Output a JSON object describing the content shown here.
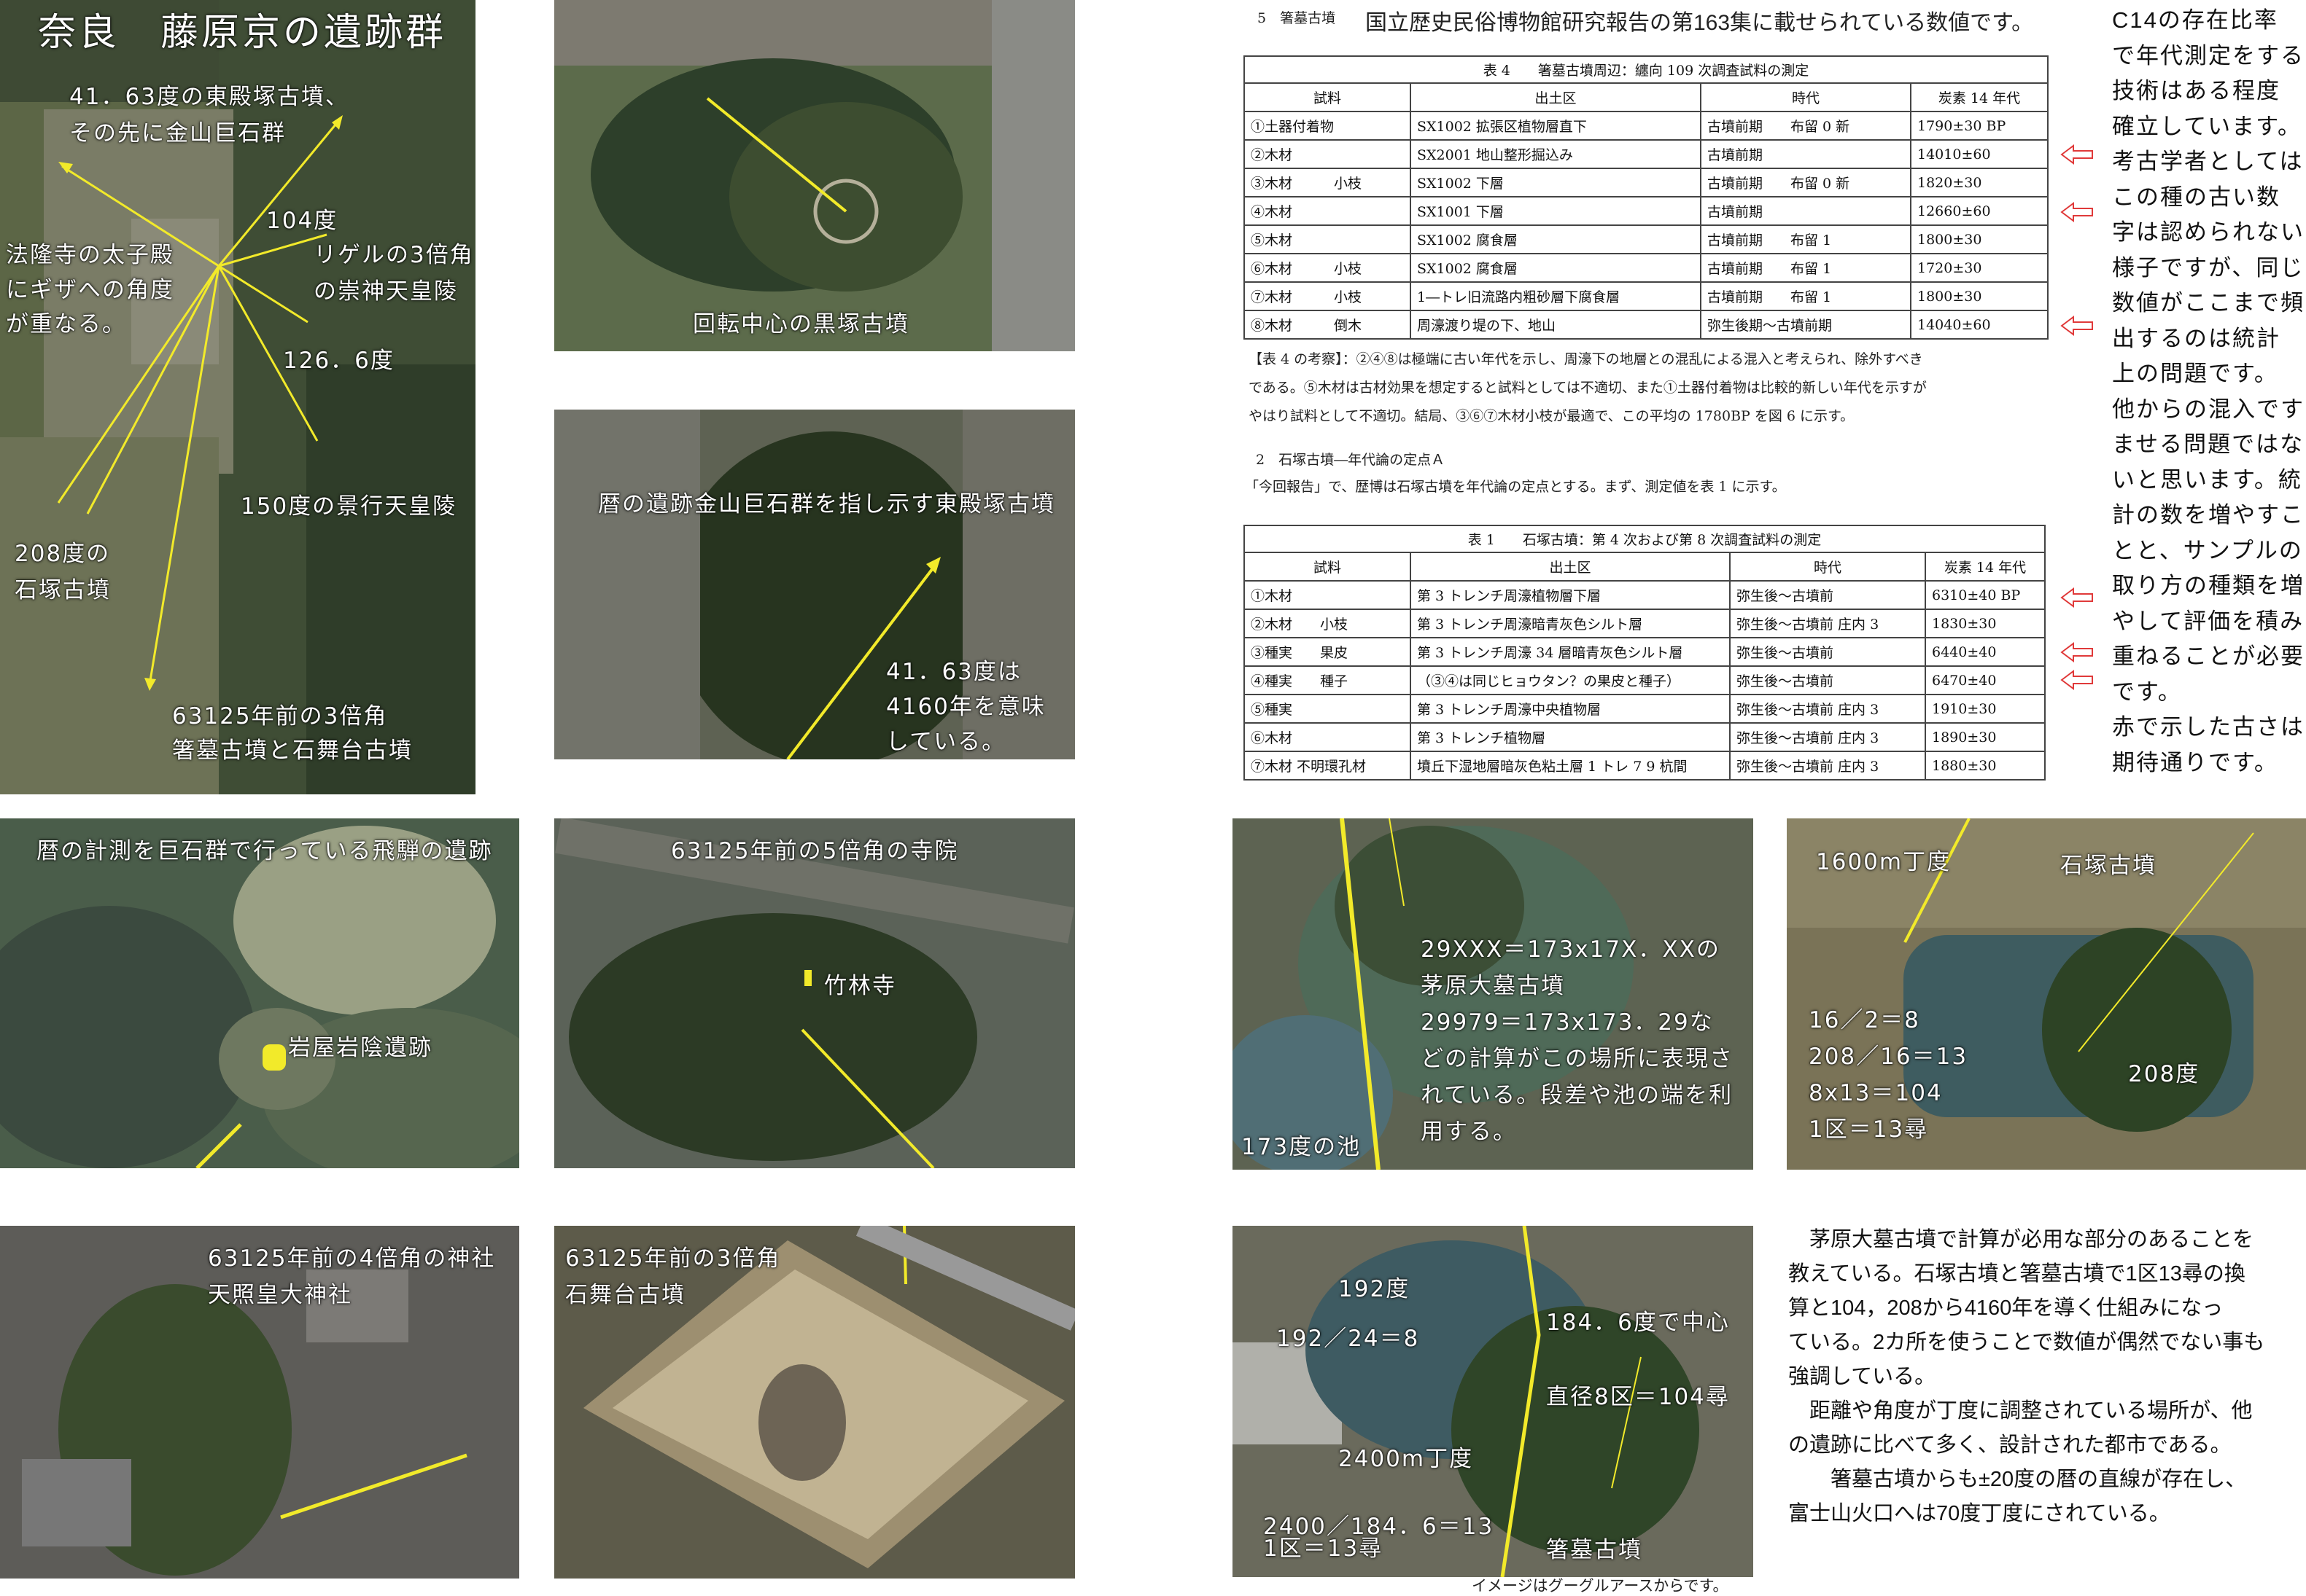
{
  "panels": {
    "main": {
      "title": "奈良　藤原京の遺跡群",
      "l1": "41．63度の東殿塚古墳、",
      "l2": "その先に金山巨石群",
      "l3": "104度",
      "l4": "リゲルの3倍角",
      "l5": "の崇神天皇陵",
      "l6": "法隆寺の太子殿",
      "l7": "にギザへの角度",
      "l8": "が重なる。",
      "l9": "126．6度",
      "l10": "150度の景行天皇陵",
      "l11": "208度の",
      "l12": "石塚古墳",
      "l13": "63125年前の3倍角",
      "l14": "箸墓古墳と石舞台古墳"
    },
    "kurozuka": {
      "label": "回転中心の黒塚古墳"
    },
    "higashitono": {
      "label": "暦の遺跡金山巨石群を指し示す東殿塚古墳",
      "n1": "41．63度は",
      "n2": "4160年を意味",
      "n3": "している。"
    },
    "iwaya": {
      "title": "暦の計測を巨石群で行っている飛騨の遺跡",
      "label": "岩屋岩陰遺跡"
    },
    "chikurin": {
      "title": "63125年前の5倍角の寺院",
      "label": "竹林寺"
    },
    "jinja": {
      "l1": "63125年前の4倍角の神社",
      "l2": "天照皇大神社"
    },
    "ishibutai": {
      "l1": "63125年前の3倍角",
      "l2": "石舞台古墳"
    },
    "chihara": {
      "t1": "29XXX＝173x17X．XXの",
      "t2": "茅原大墓古墳",
      "t3": "29979＝173x173．29な",
      "t4": "どの計算がこの場所に表現さ",
      "t5": "れている。段差や池の端を利",
      "t6": "用する。",
      "pond": "173度の池"
    },
    "ishizuka": {
      "l1": "1600m丁度",
      "l2": "石塚古墳",
      "l3": "16／2＝8",
      "l4": "208／16＝13",
      "l5": "8x13＝104",
      "l6": "1区＝13尋",
      "l7": "208度"
    },
    "hashihaka": {
      "l1": "192度",
      "l2": "192／24＝8",
      "l3": "184．6度で中心",
      "l4": "直径8区＝104尋",
      "l5": "2400m丁度",
      "l6": "2400／184．6＝13",
      "l7": "1区＝13尋",
      "l8": "箸墓古墳"
    }
  },
  "header_note": {
    "num": "5　箸墓古墳",
    "text": "国立歴史民俗博物館研究報告の第163集に載せられている数値です。"
  },
  "table4": {
    "caption": "表 4　　箸墓古墳周辺：纏向 109 次調査試料の測定",
    "headers": [
      "試料",
      "出土区",
      "時代",
      "炭素 14 年代"
    ],
    "rows": [
      [
        "①土器付着物",
        "SX1002 拡張区植物層直下",
        "古墳前期　　布留 0 新",
        "1790±30 BP"
      ],
      [
        "②木材",
        "SX2001 地山整形掘込み",
        "古墳前期",
        "14010±60"
      ],
      [
        "③木材　　　小枝",
        "SX1002 下層",
        "古墳前期　　布留 0 新",
        "1820±30"
      ],
      [
        "④木材",
        "SX1001 下層",
        "古墳前期",
        "12660±60"
      ],
      [
        "⑤木材",
        "SX1002 腐食層",
        "古墳前期　　布留 1",
        "1800±30"
      ],
      [
        "⑥木材　　　小枝",
        "SX1002 腐食層",
        "古墳前期　　布留 1",
        "1720±30"
      ],
      [
        "⑦木材　　　小枝",
        "1―トレ旧流路内粗砂層下腐食層",
        "古墳前期　　布留 1",
        "1800±30"
      ],
      [
        "⑧木材　　　倒木",
        "周濠渡り堤の下、地山",
        "弥生後期～古墳前期",
        "14040±60"
      ]
    ],
    "note1": "【表 4 の考察】：②④⑧は極端に古い年代を示し、周濠下の地層との混乱による混入と考えられ、除外すべき",
    "note2": "である。⑤木材は古材効果を想定すると試料としては不適切、また①土器付着物は比較的新しい年代を示すが",
    "note3": "やはり試料として不適切。結局、③⑥⑦木材小枝が最適で、この平均の 1780BP を図 6 に示す。"
  },
  "section2": {
    "title": "2　石塚古墳―年代論の定点Ａ",
    "text": "「今回報告」で、歴博は石塚古墳を年代論の定点とする。まず、測定値を表 1 に示す。"
  },
  "table1": {
    "caption": "表 1　　石塚古墳：第 4 次および第 8 次調査試料の測定",
    "headers": [
      "試料",
      "出土区",
      "時代",
      "炭素 14 年代"
    ],
    "rows": [
      [
        "①木材",
        "第 3 トレンチ周濠植物層下層",
        "弥生後～古墳前",
        "6310±40 BP"
      ],
      [
        "②木材　　小枝",
        "第 3 トレンチ周濠暗青灰色シルト層",
        "弥生後～古墳前 庄内 3",
        "1830±30"
      ],
      [
        "③種実　　果皮",
        "第 3 トレンチ周濠 34 層暗青灰色シルト層",
        "弥生後～古墳前",
        "6440±40"
      ],
      [
        "④種実　　種子",
        "（③④は同じヒョウタン？の果皮と種子）",
        "弥生後～古墳前",
        "6470±40"
      ],
      [
        "⑤種実",
        "第 3 トレンチ周濠中央植物層",
        "弥生後～古墳前 庄内 3",
        "1910±30"
      ],
      [
        "⑥木材",
        "第 3 トレンチ植物層",
        "弥生後～古墳前 庄内 3",
        "1890±30"
      ],
      [
        "⑦木材 不明環孔材",
        "墳丘下湿地層暗灰色粘土層 1 トレ 7 9 杭間",
        "弥生後～古墳前 庄内 3",
        "1880±30"
      ]
    ]
  },
  "right_column": [
    "C14の存在比率",
    "で年代測定をする",
    "技術はある程度",
    "確立しています。",
    "考古学者としては",
    "この種の古い数",
    "字は認められない",
    "様子ですが、同じ",
    "数値がここまで頻",
    "出するのは統計",
    "上の問題です。",
    "他からの混入です",
    "ませる問題ではな",
    "いと思います。統",
    "計の数を増やすこ",
    "とと、サンプルの",
    "取り方の種類を増",
    "やして評価を積み",
    "重ねることが必要",
    "です。",
    "赤で示した古さは",
    "期待通りです。"
  ],
  "bottom_text": {
    "p1": [
      "　茅原大墓古墳で計算が必用な部分のあることを",
      "教えている。石塚古墳と箸墓古墳で1区13尋の換",
      "算と104，208から4160年を導く仕組みになっ",
      "ている。2カ所を使うことで数値が偶然でない事も",
      "強調している。"
    ],
    "p2": [
      "　距離や角度が丁度に調整されている場所が、他",
      "の遺跡に比べて多く、設計された都市である。"
    ],
    "p3": [
      "　　箸墓古墳からも±20度の暦の直線が存在し、",
      "富士山火口へは70度丁度にされている。"
    ]
  },
  "credit": "イメージはグーグルアースからです。",
  "colors": {
    "yellow": "#f2ea2a",
    "red_arrow": "#e03a3a"
  }
}
